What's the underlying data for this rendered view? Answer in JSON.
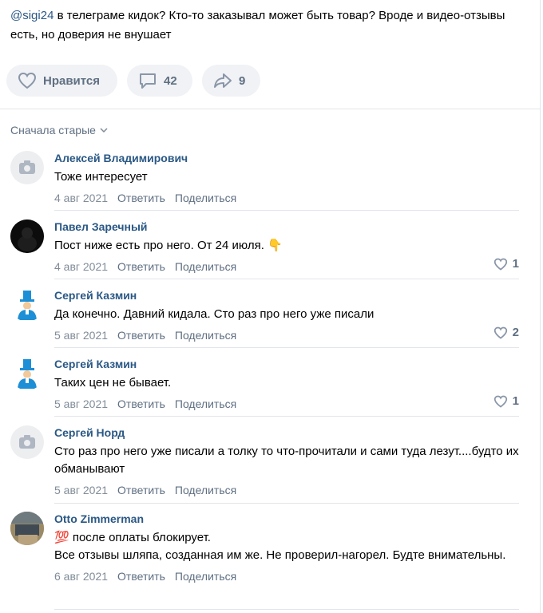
{
  "post": {
    "mention": "@sigi24",
    "text": " в телеграме кидок? Кто-то заказывал может быть товар? Вроде и видео-отзывы есть, но доверия не внушает"
  },
  "actions": {
    "like_label": "Нравится",
    "comments_count": "42",
    "shares_count": "9"
  },
  "sort_label": "Сначала старые",
  "comments": [
    {
      "author": "Алексей Владимирович",
      "text": "Тоже интересует",
      "date": "4 авг 2021",
      "reply": "Ответить",
      "share": "Поделиться",
      "likes": "",
      "avatar": "camera-icon"
    },
    {
      "author": "Павел Заречный",
      "text": "Пост ниже есть про него. От 24 июля. 👇",
      "date": "4 авг 2021",
      "reply": "Ответить",
      "share": "Поделиться",
      "likes": "1",
      "avatar": "dark-photo"
    },
    {
      "author": "Сергей Казмин",
      "text": "Да конечно. Давний кидала. Сто раз про него уже писали",
      "date": "5 авг 2021",
      "reply": "Ответить",
      "share": "Поделиться",
      "likes": "2",
      "avatar": "tophat-figure"
    },
    {
      "author": "Сергей Казмин",
      "text": "Таких цен не бывает.",
      "date": "5 авг 2021",
      "reply": "Ответить",
      "share": "Поделиться",
      "likes": "1",
      "avatar": "tophat-figure"
    },
    {
      "author": "Сергей Норд",
      "text": "Сто раз про него уже писали а толку то что-прочитали и сами туда лезут....будто их обманывают",
      "date": "5 авг 2021",
      "reply": "Ответить",
      "share": "Поделиться",
      "likes": "",
      "avatar": "camera-icon"
    },
    {
      "author": "Otto Zimmerman",
      "text_line1": "💯 после оплаты блокирует.",
      "text_line2": "Все отзывы шляпа, созданная им же. Не проверил-нагорел. Будте внимательны.",
      "date": "6 авг 2021",
      "reply": "Ответить",
      "share": "Поделиться",
      "likes": "",
      "avatar": "photo"
    }
  ],
  "colors": {
    "link": "#2a5885",
    "muted": "#818c99",
    "pill_bg": "#f0f2f5"
  }
}
